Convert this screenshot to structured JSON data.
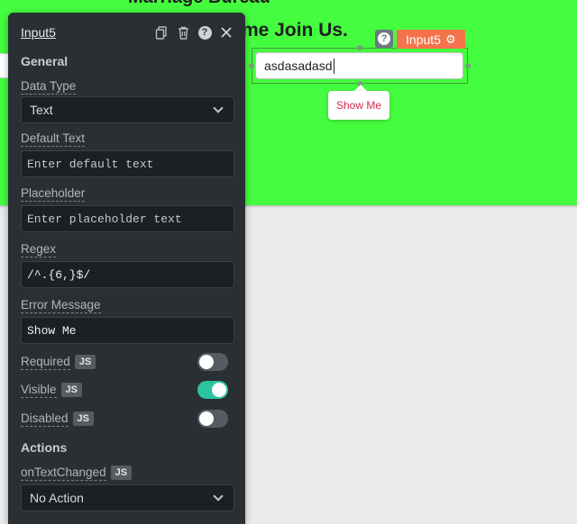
{
  "canvas": {
    "heading_top": "Marriage Bureau",
    "heading_join": "me Join Us.",
    "input_value": "asdasadasd",
    "widget_name": "Input5",
    "tooltip": "Show Me",
    "colors": {
      "canvas_bg": "#45fd3f",
      "tag_bg": "#f4734a"
    }
  },
  "pane": {
    "title": "Input5",
    "sections": {
      "general": "General",
      "actions": "Actions"
    },
    "data_type": {
      "label": "Data Type",
      "value": "Text"
    },
    "default_text": {
      "label": "Default Text",
      "placeholder": "Enter default text"
    },
    "placeholder": {
      "label": "Placeholder",
      "placeholder": "Enter placeholder text"
    },
    "regex": {
      "label": "Regex",
      "value": "/^.{6,}$/"
    },
    "error_message": {
      "label": "Error Message",
      "value": "Show Me"
    },
    "toggles": [
      {
        "label": "Required",
        "js": "JS",
        "on": false
      },
      {
        "label": "Visible",
        "js": "JS",
        "on": true
      },
      {
        "label": "Disabled",
        "js": "JS",
        "on": false
      }
    ],
    "on_text_changed": {
      "label": "onTextChanged",
      "js": "JS",
      "value": "No Action"
    },
    "colors": {
      "pane_bg": "#2a2f33",
      "toggle_on": "#2ec4a0"
    }
  }
}
